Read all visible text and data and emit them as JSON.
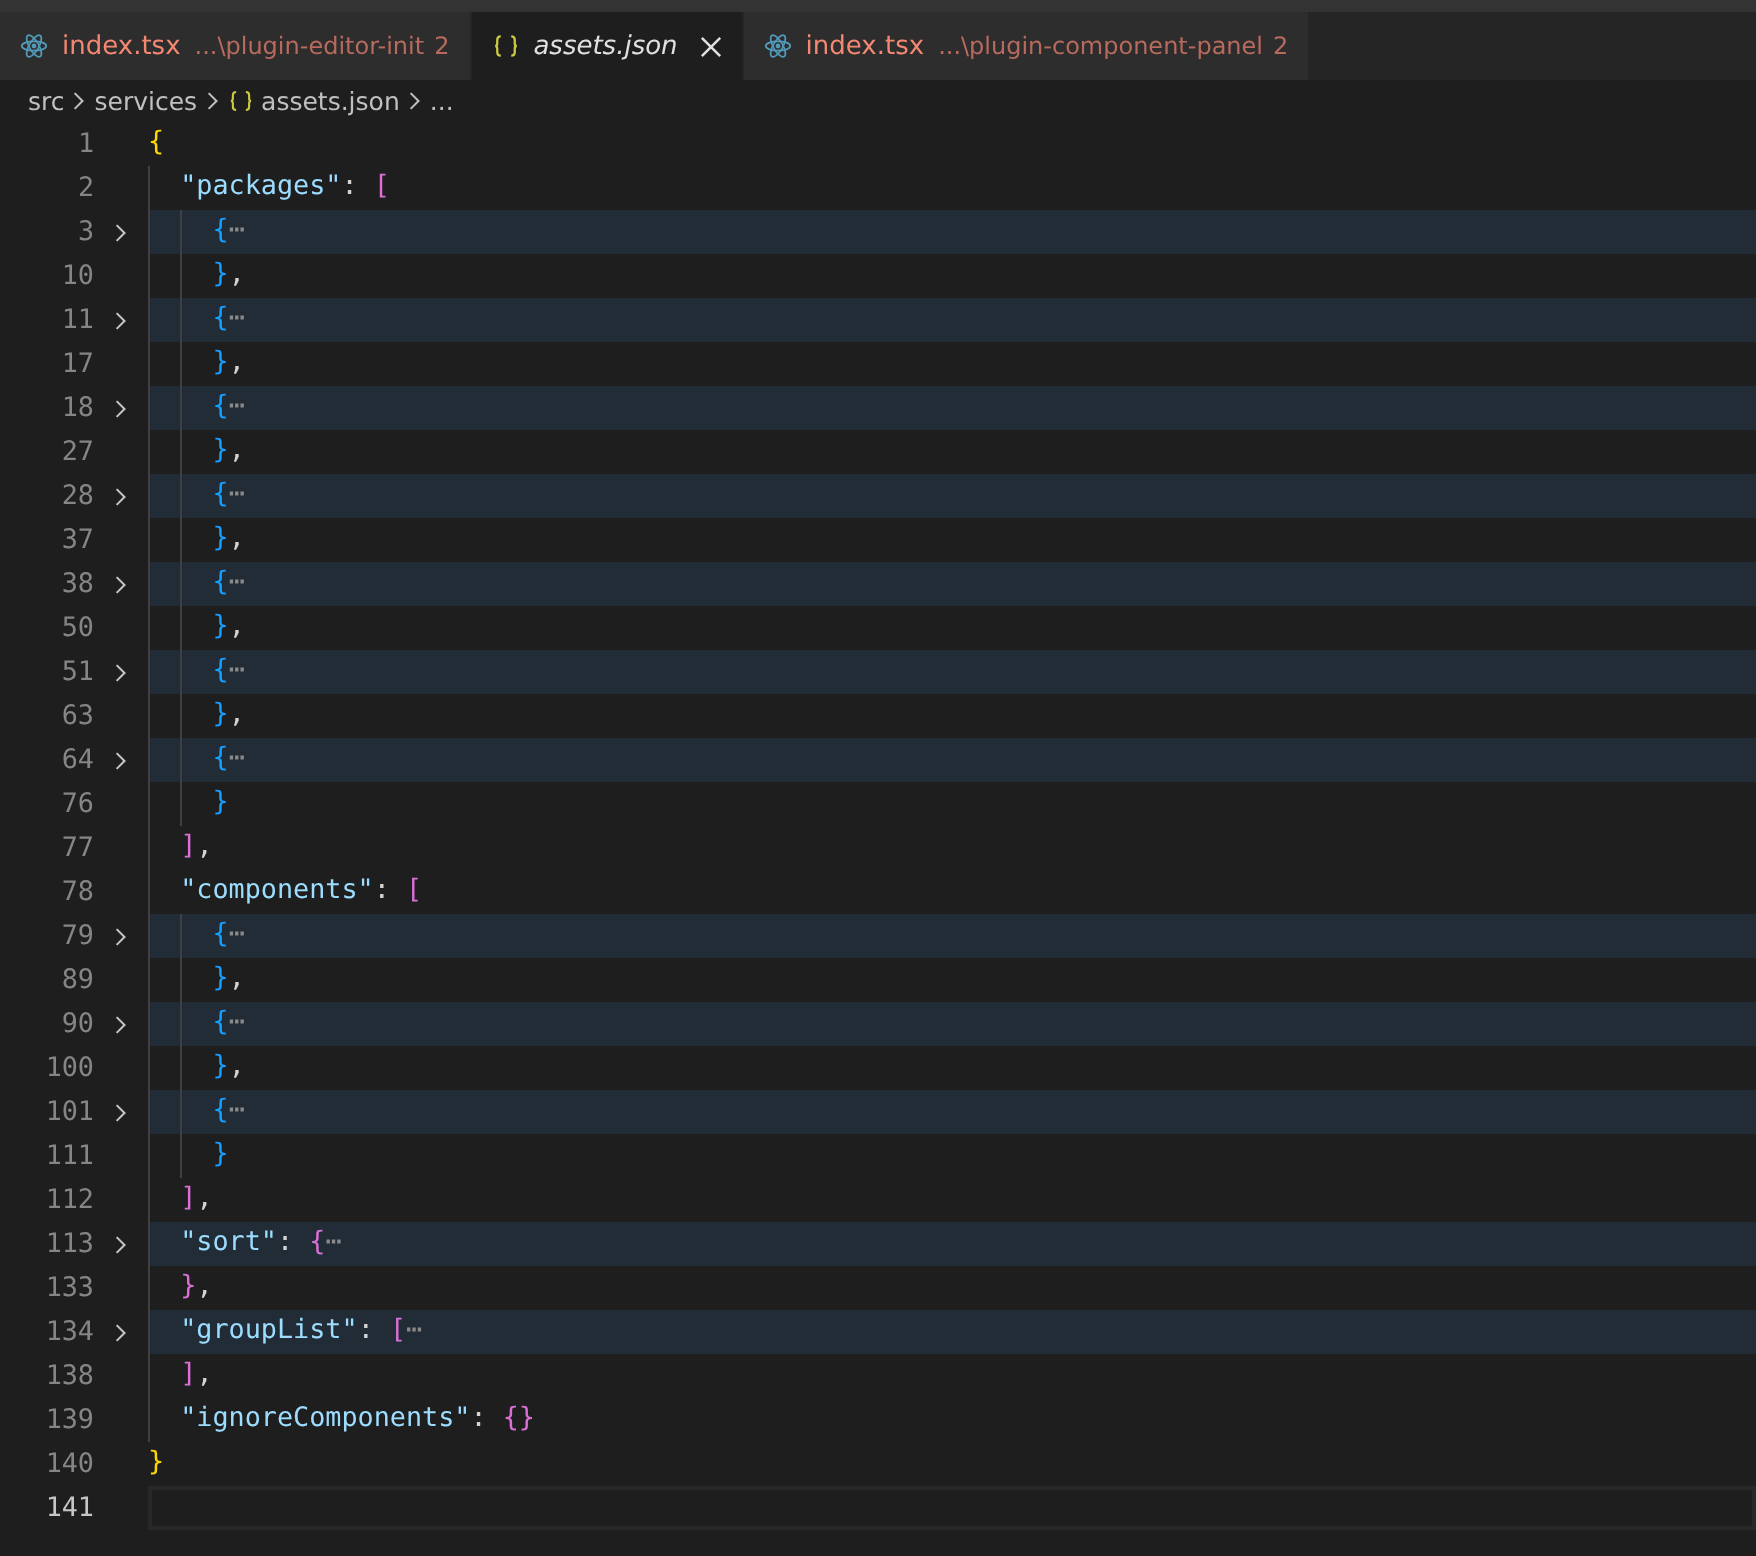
{
  "tabs": [
    {
      "kind": "react",
      "name": "index.tsx",
      "path": "...\\plugin-editor-init",
      "badge": "2",
      "selected": false,
      "preview": false
    },
    {
      "kind": "json",
      "name": "assets.json",
      "selected": true,
      "preview": true
    },
    {
      "kind": "react",
      "name": "index.tsx",
      "path": "...\\plugin-component-panel",
      "badge": "2",
      "selected": false,
      "preview": false
    }
  ],
  "breadcrumb": [
    {
      "kind": "folder",
      "label": "src"
    },
    {
      "kind": "folder",
      "label": "services"
    },
    {
      "kind": "json",
      "label": "assets.json"
    },
    {
      "kind": "more",
      "label": "..."
    }
  ],
  "lines": [
    {
      "number": "1",
      "folded": false,
      "current": false,
      "tokens": [
        {
          "text": "{",
          "kind": "b1"
        }
      ]
    },
    {
      "number": "2",
      "folded": false,
      "current": false,
      "tokens": [
        {
          "text": "  \"packages\"",
          "kind": "key"
        },
        {
          "text": ": ",
          "kind": "punct"
        },
        {
          "text": "[",
          "kind": "b2"
        }
      ]
    },
    {
      "number": "3",
      "folded": true,
      "current": false,
      "tokens": [
        {
          "text": "    {",
          "kind": "b3"
        },
        {
          "text": "⋯",
          "kind": "fold"
        }
      ]
    },
    {
      "number": "10",
      "folded": false,
      "current": false,
      "tokens": [
        {
          "text": "    }",
          "kind": "b3"
        },
        {
          "text": ",",
          "kind": "punct"
        }
      ]
    },
    {
      "number": "11",
      "folded": true,
      "current": false,
      "tokens": [
        {
          "text": "    {",
          "kind": "b3"
        },
        {
          "text": "⋯",
          "kind": "fold"
        }
      ]
    },
    {
      "number": "17",
      "folded": false,
      "current": false,
      "tokens": [
        {
          "text": "    }",
          "kind": "b3"
        },
        {
          "text": ",",
          "kind": "punct"
        }
      ]
    },
    {
      "number": "18",
      "folded": true,
      "current": false,
      "tokens": [
        {
          "text": "    {",
          "kind": "b3"
        },
        {
          "text": "⋯",
          "kind": "fold"
        }
      ]
    },
    {
      "number": "27",
      "folded": false,
      "current": false,
      "tokens": [
        {
          "text": "    }",
          "kind": "b3"
        },
        {
          "text": ",",
          "kind": "punct"
        }
      ]
    },
    {
      "number": "28",
      "folded": true,
      "current": false,
      "tokens": [
        {
          "text": "    {",
          "kind": "b3"
        },
        {
          "text": "⋯",
          "kind": "fold"
        }
      ]
    },
    {
      "number": "37",
      "folded": false,
      "current": false,
      "tokens": [
        {
          "text": "    }",
          "kind": "b3"
        },
        {
          "text": ",",
          "kind": "punct"
        }
      ]
    },
    {
      "number": "38",
      "folded": true,
      "current": false,
      "tokens": [
        {
          "text": "    {",
          "kind": "b3"
        },
        {
          "text": "⋯",
          "kind": "fold"
        }
      ]
    },
    {
      "number": "50",
      "folded": false,
      "current": false,
      "tokens": [
        {
          "text": "    }",
          "kind": "b3"
        },
        {
          "text": ",",
          "kind": "punct"
        }
      ]
    },
    {
      "number": "51",
      "folded": true,
      "current": false,
      "tokens": [
        {
          "text": "    {",
          "kind": "b3"
        },
        {
          "text": "⋯",
          "kind": "fold"
        }
      ]
    },
    {
      "number": "63",
      "folded": false,
      "current": false,
      "tokens": [
        {
          "text": "    }",
          "kind": "b3"
        },
        {
          "text": ",",
          "kind": "punct"
        }
      ]
    },
    {
      "number": "64",
      "folded": true,
      "current": false,
      "tokens": [
        {
          "text": "    {",
          "kind": "b3"
        },
        {
          "text": "⋯",
          "kind": "fold"
        }
      ]
    },
    {
      "number": "76",
      "folded": false,
      "current": false,
      "tokens": [
        {
          "text": "    }",
          "kind": "b3"
        }
      ]
    },
    {
      "number": "77",
      "folded": false,
      "current": false,
      "tokens": [
        {
          "text": "  ]",
          "kind": "b2"
        },
        {
          "text": ",",
          "kind": "punct"
        }
      ]
    },
    {
      "number": "78",
      "folded": false,
      "current": false,
      "tokens": [
        {
          "text": "  \"components\"",
          "kind": "key"
        },
        {
          "text": ": ",
          "kind": "punct"
        },
        {
          "text": "[",
          "kind": "b2"
        }
      ]
    },
    {
      "number": "79",
      "folded": true,
      "current": false,
      "tokens": [
        {
          "text": "    {",
          "kind": "b3"
        },
        {
          "text": "⋯",
          "kind": "fold"
        }
      ]
    },
    {
      "number": "89",
      "folded": false,
      "current": false,
      "tokens": [
        {
          "text": "    }",
          "kind": "b3"
        },
        {
          "text": ",",
          "kind": "punct"
        }
      ]
    },
    {
      "number": "90",
      "folded": true,
      "current": false,
      "tokens": [
        {
          "text": "    {",
          "kind": "b3"
        },
        {
          "text": "⋯",
          "kind": "fold"
        }
      ]
    },
    {
      "number": "100",
      "folded": false,
      "current": false,
      "tokens": [
        {
          "text": "    }",
          "kind": "b3"
        },
        {
          "text": ",",
          "kind": "punct"
        }
      ]
    },
    {
      "number": "101",
      "folded": true,
      "current": false,
      "tokens": [
        {
          "text": "    {",
          "kind": "b3"
        },
        {
          "text": "⋯",
          "kind": "fold"
        }
      ]
    },
    {
      "number": "111",
      "folded": false,
      "current": false,
      "tokens": [
        {
          "text": "    }",
          "kind": "b3"
        }
      ]
    },
    {
      "number": "112",
      "folded": false,
      "current": false,
      "tokens": [
        {
          "text": "  ]",
          "kind": "b2"
        },
        {
          "text": ",",
          "kind": "punct"
        }
      ]
    },
    {
      "number": "113",
      "folded": true,
      "current": false,
      "tokens": [
        {
          "text": "  \"sort\"",
          "kind": "key"
        },
        {
          "text": ": ",
          "kind": "punct"
        },
        {
          "text": "{",
          "kind": "b2"
        },
        {
          "text": "⋯",
          "kind": "fold"
        }
      ]
    },
    {
      "number": "133",
      "folded": false,
      "current": false,
      "tokens": [
        {
          "text": "  }",
          "kind": "b2"
        },
        {
          "text": ",",
          "kind": "punct"
        }
      ]
    },
    {
      "number": "134",
      "folded": true,
      "current": false,
      "tokens": [
        {
          "text": "  \"groupList\"",
          "kind": "key"
        },
        {
          "text": ": ",
          "kind": "punct"
        },
        {
          "text": "[",
          "kind": "b2"
        },
        {
          "text": "⋯",
          "kind": "fold"
        }
      ]
    },
    {
      "number": "138",
      "folded": false,
      "current": false,
      "tokens": [
        {
          "text": "  ]",
          "kind": "b2"
        },
        {
          "text": ",",
          "kind": "punct"
        }
      ]
    },
    {
      "number": "139",
      "folded": false,
      "current": false,
      "tokens": [
        {
          "text": "  \"ignoreComponents\"",
          "kind": "key"
        },
        {
          "text": ": ",
          "kind": "punct"
        },
        {
          "text": "{}",
          "kind": "b2"
        }
      ]
    },
    {
      "number": "140",
      "folded": false,
      "current": false,
      "tokens": [
        {
          "text": "}",
          "kind": "b1"
        }
      ]
    },
    {
      "number": "141",
      "folded": false,
      "current": true
    }
  ]
}
